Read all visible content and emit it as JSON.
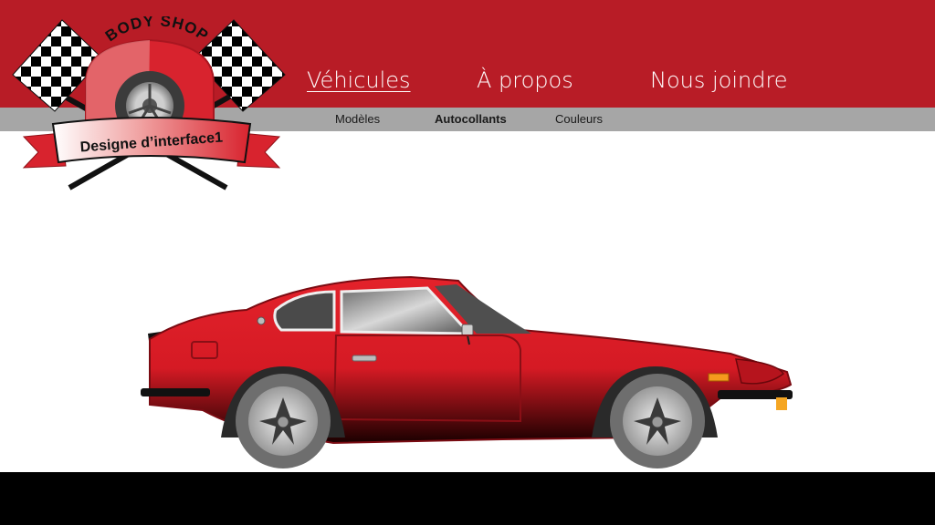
{
  "logo": {
    "top_text": "BODY SHOP",
    "banner_text": "Designe d’interface1"
  },
  "nav": {
    "items": [
      {
        "label": "Véhicules",
        "active": true
      },
      {
        "label": "À propos",
        "active": false
      },
      {
        "label": "Nous joindre",
        "active": false
      }
    ]
  },
  "subnav": {
    "items": [
      {
        "label": "Modèles",
        "active": false
      },
      {
        "label": "Autocollants",
        "active": true
      },
      {
        "label": "Couleurs",
        "active": false
      }
    ]
  },
  "hero": {
    "image": "red-sports-car",
    "car_color": "#d71a24"
  },
  "colors": {
    "header": "#b81c26",
    "subnav": "#a6a6a6",
    "footer": "#000000"
  }
}
